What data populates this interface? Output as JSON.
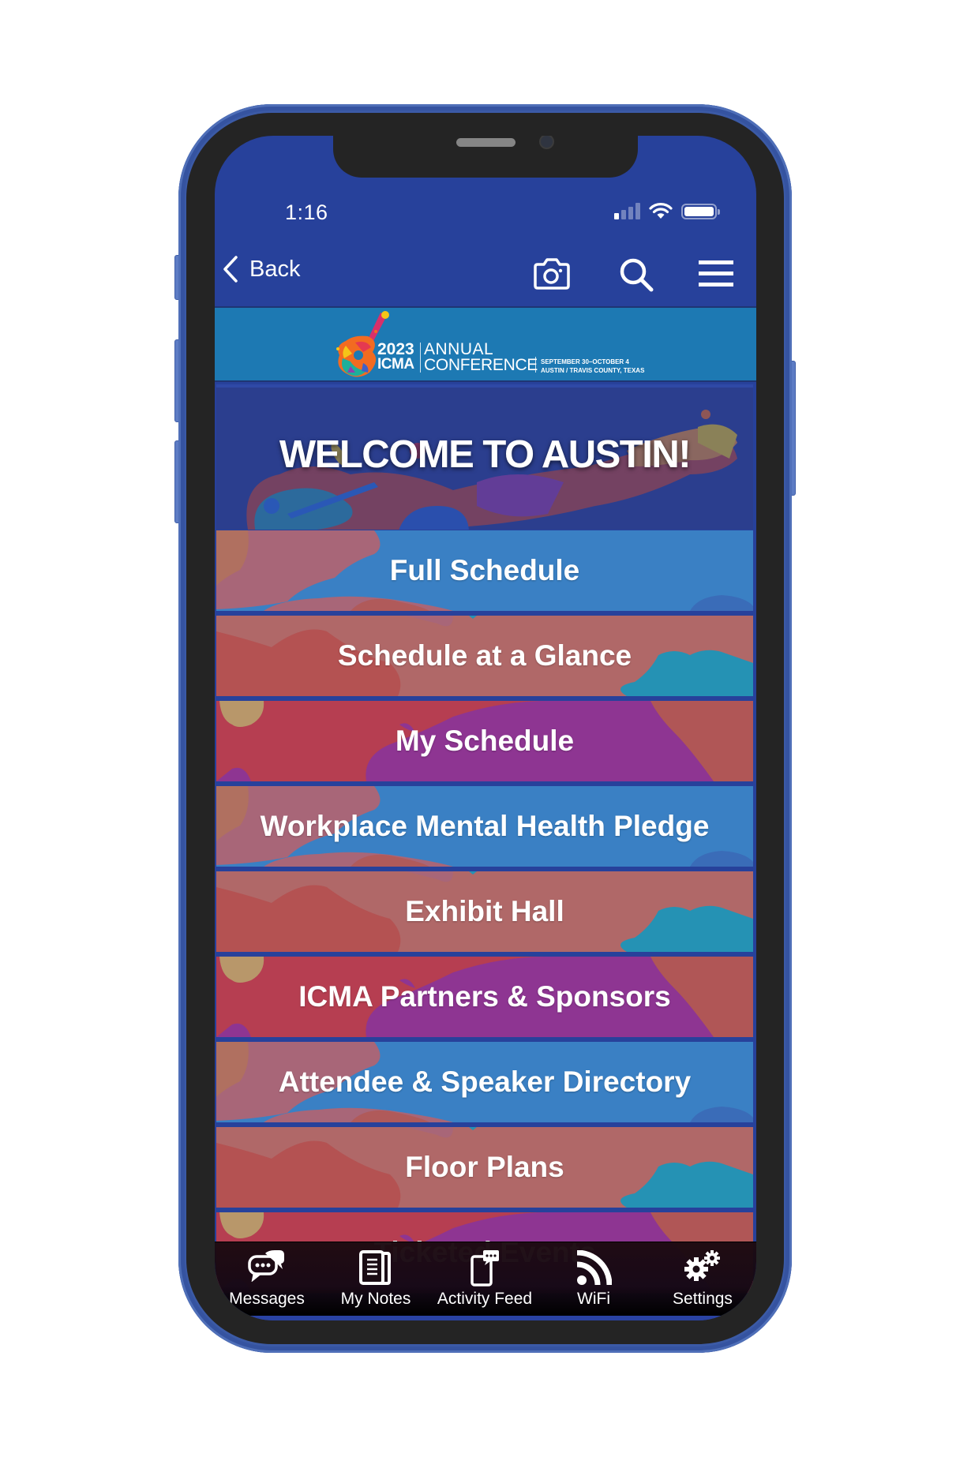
{
  "status_bar": {
    "time": "1:16",
    "signal_bars_on": 1,
    "signal_bars_total": 4,
    "wifi_icon": "wifi-icon",
    "battery_icon": "battery-full-icon"
  },
  "nav": {
    "back_label": "Back",
    "back_icon": "chevron-left-icon",
    "camera_icon": "camera-icon",
    "search_icon": "search-icon",
    "menu_icon": "hamburger-menu-icon"
  },
  "banner": {
    "year": "2023",
    "org": "ICMA",
    "line1": "ANNUAL",
    "line2": "CONFERENCE",
    "dates": "SEPTEMBER 30–OCTOBER 4",
    "location": "AUSTIN / TRAVIS COUNTY, TEXAS",
    "logo_icon": "guitar-logo-icon"
  },
  "welcome": {
    "title": "WELCOME TO AUSTIN!"
  },
  "menu": {
    "items": [
      {
        "label": "Full Schedule",
        "pattern": "blue"
      },
      {
        "label": "Schedule at a Glance",
        "pattern": "salmon"
      },
      {
        "label": "My Schedule",
        "pattern": "purple"
      },
      {
        "label": "Workplace Mental Health Pledge",
        "pattern": "blue"
      },
      {
        "label": "Exhibit Hall",
        "pattern": "salmon"
      },
      {
        "label": "ICMA Partners & Sponsors",
        "pattern": "purple"
      },
      {
        "label": "Attendee & Speaker Directory",
        "pattern": "blue"
      },
      {
        "label": "Floor Plans",
        "pattern": "salmon"
      },
      {
        "label": "Ticketed Events",
        "pattern": "purple"
      }
    ]
  },
  "tabbar": {
    "tabs": [
      {
        "label": "Messages",
        "icon": "chat-bubbles-icon"
      },
      {
        "label": "My Notes",
        "icon": "notes-icon"
      },
      {
        "label": "Activity Feed",
        "icon": "phone-message-icon"
      },
      {
        "label": "WiFi",
        "icon": "rss-wifi-icon"
      },
      {
        "label": "Settings",
        "icon": "gears-icon"
      }
    ]
  },
  "colors": {
    "nav_blue": "#27419b",
    "banner_blue": "#1d79b3",
    "welcome_bg": "#2b3e8e",
    "row_blue": "#3a80c4",
    "row_salmon": "#b06868",
    "row_red": "#b63e51",
    "row_purple": "#8e3592",
    "row_teal": "#2592b4",
    "phone_frame": "#3b5aa6"
  }
}
